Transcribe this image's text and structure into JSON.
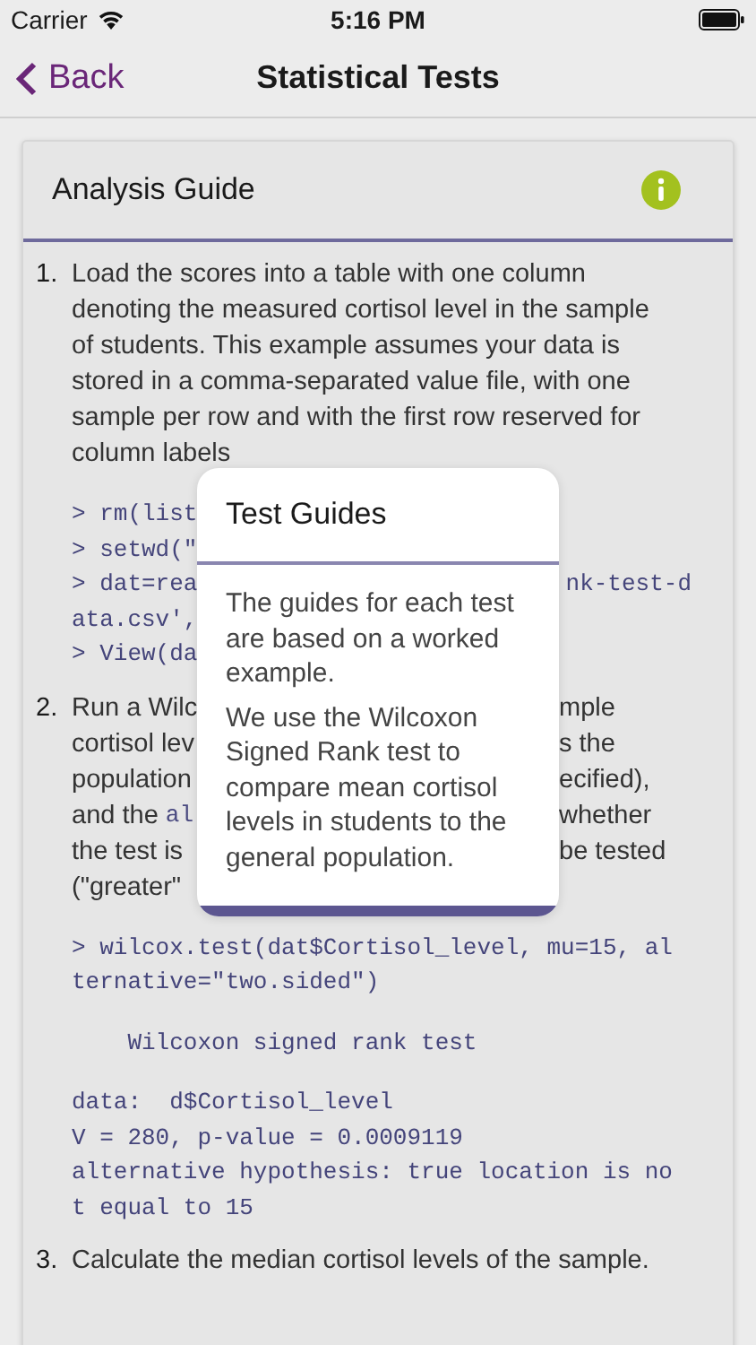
{
  "status_bar": {
    "carrier": "Carrier",
    "time": "5:16 PM"
  },
  "nav": {
    "back": "Back",
    "title": "Statistical Tests"
  },
  "card": {
    "title": "Analysis Guide",
    "steps": [
      {
        "number": "1.",
        "text": "Load the scores into a table with one column denoting the measured cortisol level in the sample of students. This example assumes your data is stored in a comma-separated value file, with one sample per row and with the first row reserved for column labels",
        "code_blocks": [
          [
            {
              "left": "> rm(list"
            },
            {
              "left": "> setwd(\""
            },
            {
              "left": "> dat=rea",
              "right": "nk-test-d"
            },
            {
              "left": "ata.csv',"
            },
            {
              "left": "> View(da"
            }
          ]
        ]
      },
      {
        "number": "2.",
        "text_lines": [
          {
            "left": "Run a Wilc",
            "right": "mple"
          },
          {
            "left": "cortisol lev",
            "right": "s the"
          },
          {
            "left": "population",
            "right": "ecified),"
          },
          {
            "left": "and the",
            "left_code": "al",
            "right": "whether"
          },
          {
            "left": "the test is",
            "right": "be tested"
          },
          {
            "left": "(\"greater\""
          }
        ],
        "code_blocks": [
          [
            {
              "left": "> wilcox.test(dat$Cortisol_level, mu=15, al"
            },
            {
              "left": "ternative=\"two.sided\")"
            }
          ],
          [
            {
              "left": "    Wilcoxon signed rank test"
            }
          ],
          [
            {
              "left": "data:  d$Cortisol_level"
            },
            {
              "left": "V = 280, p-value = 0.0009119"
            },
            {
              "left": "alternative hypothesis: true location is no"
            },
            {
              "left": "t equal to 15"
            }
          ]
        ]
      },
      {
        "number": "3.",
        "text": "Calculate the median cortisol levels of the sample."
      }
    ]
  },
  "popup": {
    "title": "Test Guides",
    "paragraphs": [
      "The guides for each test are based on a worked example.",
      "We use the Wilcoxon Signed Rank test to compare mean cortisol levels in students to the general population."
    ]
  }
}
